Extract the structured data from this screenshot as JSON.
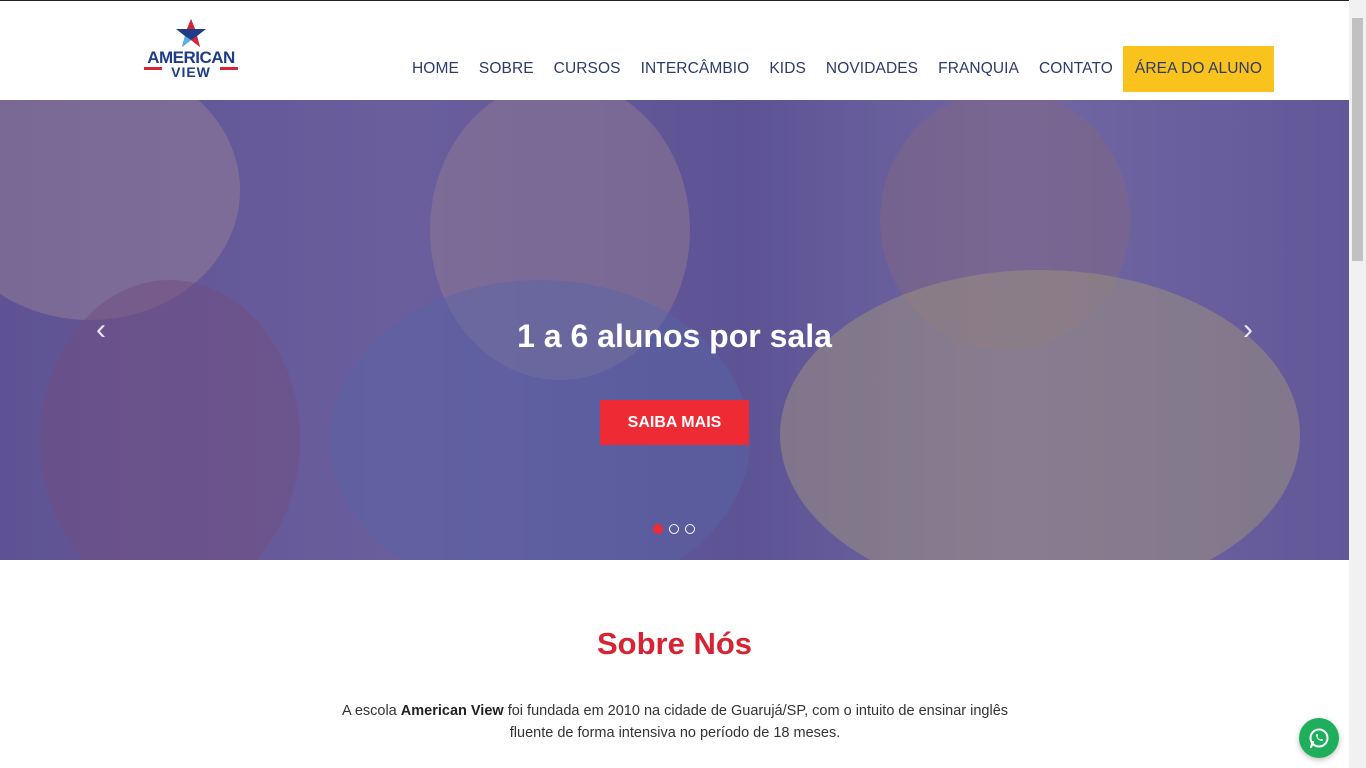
{
  "logo": {
    "line1": "AMERICAN",
    "line2": "VIEW"
  },
  "nav": {
    "items": [
      "HOME",
      "SOBRE",
      "CURSOS",
      "INTERCÂMBIO",
      "KIDS",
      "NOVIDADES",
      "FRANQUIA",
      "CONTATO"
    ],
    "cta": "ÁREA DO ALUNO"
  },
  "hero": {
    "title": "1 a 6 alunos por sala",
    "button": "SAIBA MAIS",
    "slides_total": 3,
    "active_slide": 1
  },
  "sobre": {
    "title": "Sobre Nós",
    "text_prefix": "A escola ",
    "text_brand": "American View",
    "text_suffix": " foi fundada em 2010 na cidade de Guarujá/SP, com o intuito de ensinar inglês fluente de forma intensiva no período de 18 meses."
  },
  "colors": {
    "accent": "#ee2a35",
    "cta": "#f9c21c",
    "nav_text": "#2d3a6b",
    "whatsapp": "#1fae5b"
  }
}
